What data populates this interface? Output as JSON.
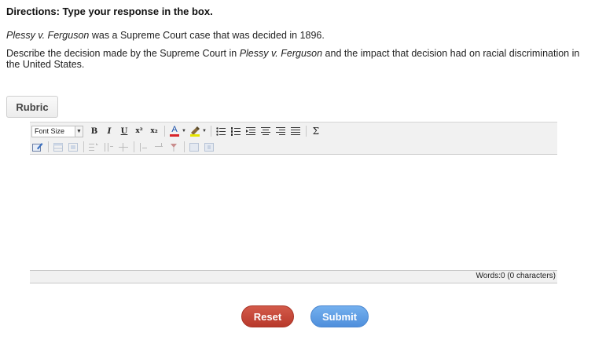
{
  "directions": "Directions: Type your response in the box.",
  "prompt": {
    "p1_case": "Plessy v. Ferguson",
    "p1_rest": " was a Supreme Court case that was decided in 1896.",
    "p2_before": "Describe the decision made by the Supreme Court in ",
    "p2_case": "Plessy v. Ferguson",
    "p2_after": " and the impact that decision had on racial discrimination in the United States."
  },
  "rubric_label": "Rubric",
  "editor": {
    "font_size_label": "Font Size",
    "toolbar": {
      "bold": "B",
      "italic": "I",
      "underline": "U",
      "superscript": "x²",
      "subscript": "x₂",
      "font_color": "A",
      "sigma": "Σ"
    },
    "body_text": "",
    "word_count": "Words:0 (0 characters)"
  },
  "colors": {
    "reset": "#c4493a",
    "submit": "#5f9fe6"
  },
  "buttons": {
    "reset": "Reset",
    "submit": "Submit"
  }
}
